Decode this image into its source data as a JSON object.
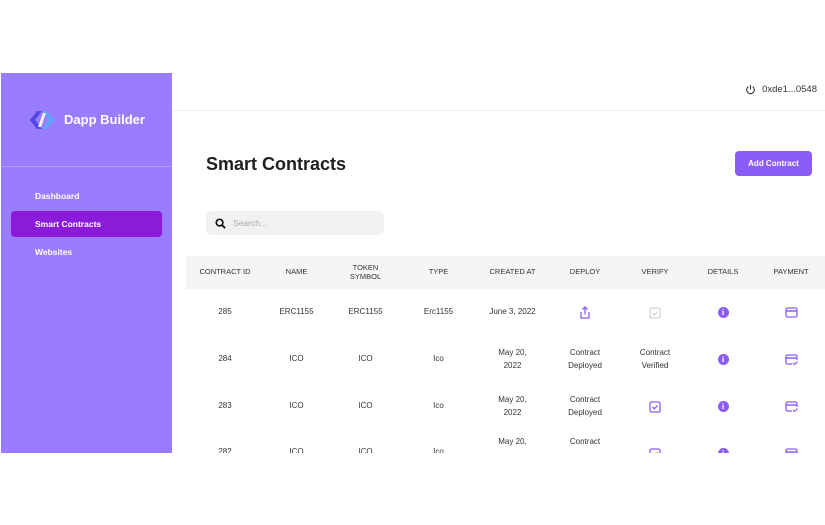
{
  "brand": {
    "name": "Dapp Builder"
  },
  "sidebar": {
    "items": [
      {
        "label": "Dashboard",
        "active": false
      },
      {
        "label": "Smart Contracts",
        "active": true
      },
      {
        "label": "Websites",
        "active": false
      }
    ]
  },
  "topbar": {
    "wallet_address": "0xde1...0548",
    "power_icon": "power-icon"
  },
  "page": {
    "title": "Smart Contracts",
    "add_button": "Add Contract"
  },
  "search": {
    "placeholder": "Search...",
    "icon": "search-icon"
  },
  "table": {
    "headers": [
      "CONTRACT ID",
      "NAME",
      "TOKEN SYMBOL",
      "TYPE",
      "CREATED AT",
      "DEPLOY",
      "VERIFY",
      "DETAILS",
      "PAYMENT"
    ],
    "rows": [
      {
        "id": "285",
        "name": "ERC1155",
        "symbol": "ERC1155",
        "type": "Erc1155",
        "created": "June 3, 2022",
        "deploy": "",
        "verify": "",
        "deploy_icon": "upload-icon",
        "verify_icon": "checkbox-disabled-icon",
        "payment_icon": "credit-card-icon"
      },
      {
        "id": "284",
        "name": "ICO",
        "symbol": "ICO",
        "type": "Ico",
        "created": "May 20, 2022",
        "deploy": "Contract Deployed",
        "verify": "Contract Verified",
        "payment_icon": "card-check-icon"
      },
      {
        "id": "283",
        "name": "ICO",
        "symbol": "ICO",
        "type": "Ico",
        "created": "May 20, 2022",
        "deploy": "Contract Deployed",
        "verify": "",
        "verify_icon": "checkbox-checked-icon",
        "payment_icon": "card-check-icon"
      },
      {
        "id": "282",
        "name": "ICO",
        "symbol": "ICO",
        "type": "Ico",
        "created": "May 20,",
        "deploy": "Contract",
        "verify": "",
        "verify_icon": "checkbox-checked-icon",
        "payment_icon": "credit-card-icon"
      }
    ]
  },
  "colors": {
    "sidebar": "#9a7cff",
    "active_nav": "#8b1bd9",
    "accent": "#8b5cf6"
  }
}
